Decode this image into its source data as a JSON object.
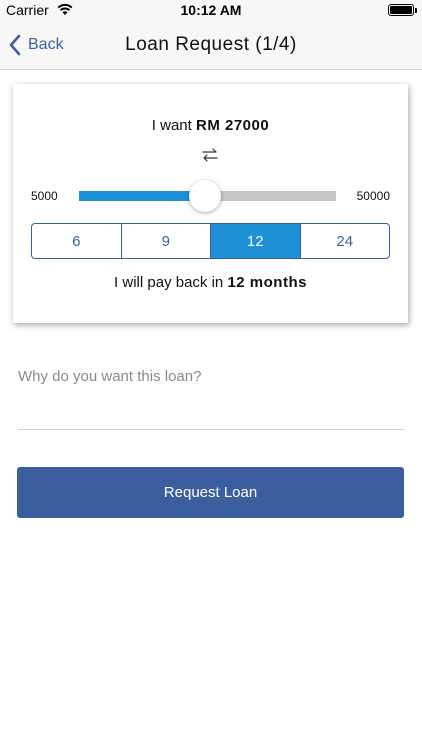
{
  "status_bar": {
    "carrier": "Carrier",
    "time": "10:12 AM"
  },
  "nav": {
    "back_label": "Back",
    "title": "Loan Request (1/4)"
  },
  "amount": {
    "prefix": "I want ",
    "value": "RM 27000",
    "min_label": "5000",
    "max_label": "50000",
    "min": 5000,
    "max": 50000,
    "current": 27000
  },
  "term": {
    "options": [
      "6",
      "9",
      "12",
      "24"
    ],
    "selected": "12",
    "payback_prefix": "I will pay back in ",
    "payback_value": "12 months"
  },
  "reason": {
    "placeholder": "Why do you want this loan?",
    "value": ""
  },
  "request_button": {
    "label": "Request Loan"
  },
  "colors": {
    "accent": "#1e90d5",
    "brand": "#3b5e9e",
    "link": "#3a5fa5",
    "track": "#c6c6c6"
  },
  "icons": {
    "back": "chevron-left-icon",
    "swap": "swap-arrows-icon",
    "wifi": "wifi-icon",
    "battery": "battery-icon"
  }
}
